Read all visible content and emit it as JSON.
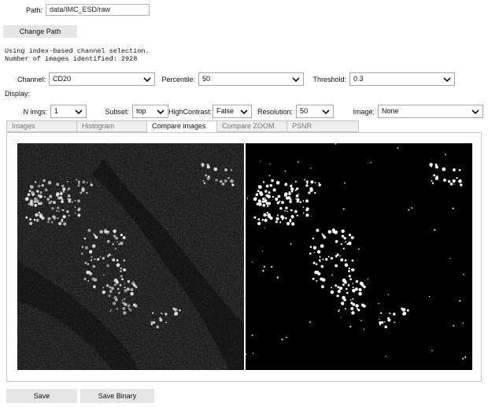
{
  "path": {
    "label": "Path:",
    "value": "data/IMC_ESD/raw"
  },
  "change_path_label": "Change Path",
  "info_lines": [
    "Using index-based channel selection.",
    "Number of images identified: 2928"
  ],
  "controls": {
    "channel": {
      "label": "Channel:",
      "value": "CD20"
    },
    "percentile": {
      "label": "Percentile:",
      "value": "50"
    },
    "threshold": {
      "label": "Threshold:",
      "value": "0.3"
    }
  },
  "display_label": "Display:",
  "display_controls": {
    "n_imgs": {
      "label": "N imgs:",
      "value": "1"
    },
    "subset": {
      "label": "Subset:",
      "value": "top"
    },
    "high_contrast": {
      "label": "HighContrast:",
      "value": "False"
    },
    "resolution": {
      "label": "Resolution:",
      "value": "50"
    },
    "image": {
      "label": "Image:",
      "value": "None"
    }
  },
  "tabs": [
    {
      "label": "Images"
    },
    {
      "label": "Histogram"
    },
    {
      "label": "Compare images"
    },
    {
      "label": "Compare ZOOM"
    },
    {
      "label": "PSNR"
    }
  ],
  "active_tab": 2,
  "buttons": {
    "save": "Save",
    "save_binary": "Save Binary"
  },
  "colors": {
    "button_bg": "#e6e6e6",
    "border": "#c6c6c6",
    "image_bg": "#000000"
  }
}
